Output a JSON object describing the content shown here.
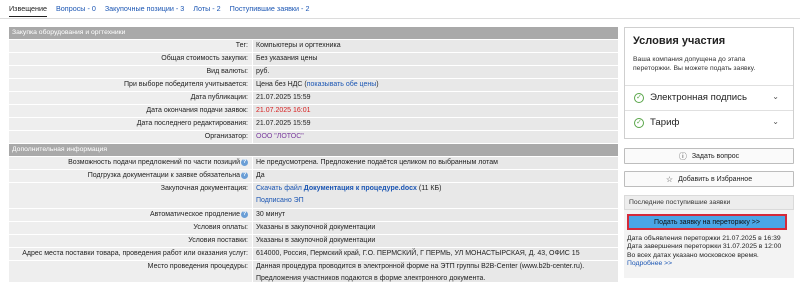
{
  "tabs": [
    {
      "label": "Извещение",
      "active": true
    },
    {
      "label": "Вопросы - 0"
    },
    {
      "label": "Закупочные позиции - 3"
    },
    {
      "label": "Лоты - 2"
    },
    {
      "label": "Поступившие заявки - 2"
    }
  ],
  "section1": {
    "title": "Закупка оборудования и оргтехники",
    "tag_label": "Тег:",
    "tag_value": "Компьютеры и оргтехника",
    "total_label": "Общая стоимость закупки:",
    "total_value": "Без указания цены",
    "currency_label": "Вид валюты:",
    "currency_value": "руб.",
    "winner_label": "При выборе победителя учитывается:",
    "winner_value": "Цена без НДС (",
    "winner_link": "показывать обе цены",
    "winner_close": ")",
    "pub_label": "Дата публикации:",
    "pub_value": "21.07.2025 15:59",
    "end_label": "Дата окончания подачи заявок:",
    "end_value": "21.07.2025 16:01",
    "edit_label": "Дата последнего редактирования:",
    "edit_value": "21.07.2025 15:59",
    "org_label": "Организатор:",
    "org_value": "ООО \"ЛОТОС\""
  },
  "section2": {
    "title": "Дополнительная информация",
    "partial_label": "Возможность подачи предложений по части позиций",
    "partial_value": "Не предусмотрена. Предложение подаётся целиком по выбранным лотам",
    "docs_required_label": "Подгрузка документации к заявке обязательна",
    "docs_required_value": "Да",
    "docs_label": "Закупочная документация:",
    "docs_link_prefix": "Скачать файл",
    "docs_link_file": "Документация к процедуре.docx",
    "docs_size": "(11 КБ)",
    "docs_signed": "Подписано ЭП",
    "extend_label": "Автоматическое продление",
    "extend_value": "30 минут",
    "payment_label": "Условия оплаты:",
    "payment_value": "Указаны в закупочной документации",
    "delivery_label": "Условия поставки:",
    "delivery_value": "Указаны в закупочной документации",
    "address_label": "Адрес места поставки товара, проведения работ или оказания услуг:",
    "address_value": "614000, Россия, Пермский край, Г.О. ПЕРМСКИЙ, Г ПЕРМЬ, УЛ МОНАСТЫРСКАЯ, Д. 43, ОФИС 15",
    "place_label": "Место проведения процедуры:",
    "place_value_1": "Данная процедура проводится в электронной форме на ЭТП группы B2B-Center (www.b2b-center.ru).",
    "place_value_2": "Предложения участников подаются в форме электронного документа."
  },
  "sidebar": {
    "title": "Условия участия",
    "text": "Ваша компания допущена до этапа переторжки. Вы можете подать заявку.",
    "signature_label": "Электронная подпись",
    "tariff_label": "Тариф",
    "ask_label": "Задать вопрос",
    "fav_label": "Добавить в Избранное",
    "recent_header": "Последние поступившие заявки",
    "apply_label": "Подать заявку на переторжку >>",
    "line1": "Дата объявления переторжки 21.07.2025 в 16:39",
    "line2": "Дата завершения переторжки 31.07.2025 в 12:00",
    "line3": "Во всех датах указано московское время.",
    "more_link": "Подробнее >>"
  },
  "colors": {
    "link": "#1a55b3",
    "header": "#a9a9a9",
    "apply_button": "#4aa6e6",
    "apply_border": "#d42a3a",
    "deadline": "#d62020",
    "organizer": "#7a3c9e"
  }
}
